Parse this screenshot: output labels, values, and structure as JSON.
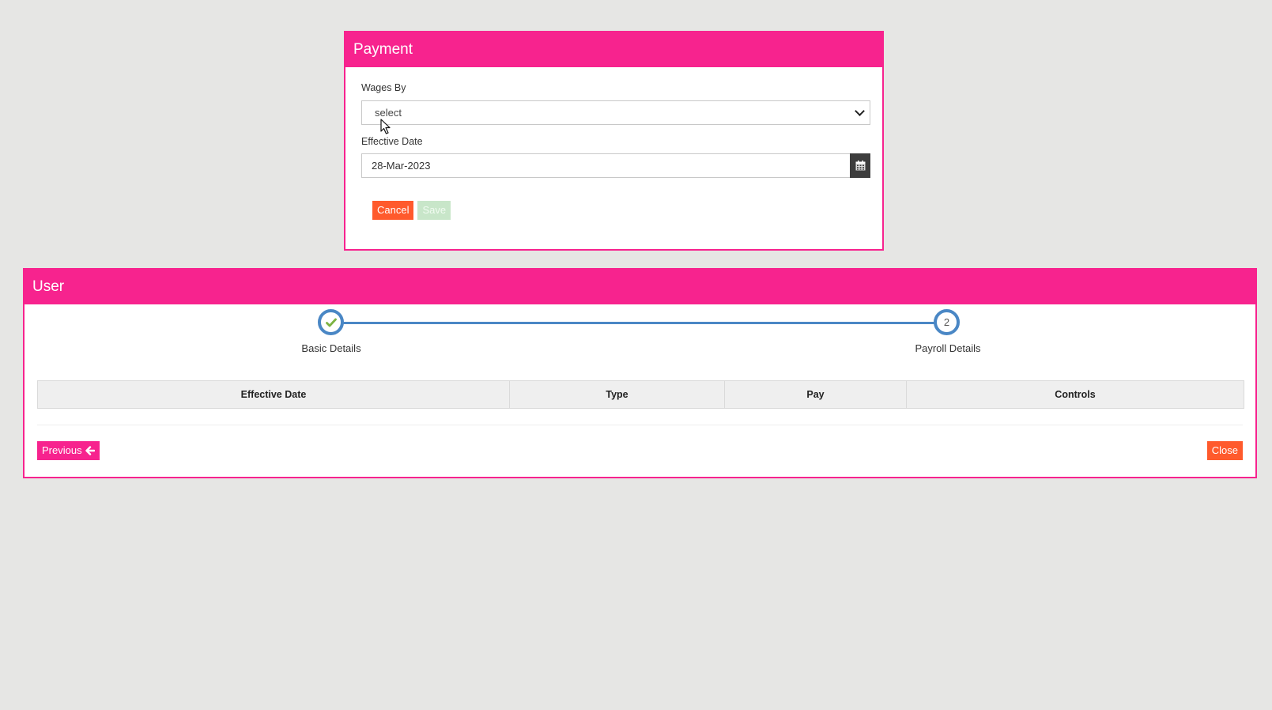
{
  "payment_modal": {
    "title": "Payment",
    "wages_by_label": "Wages By",
    "wages_by_selected": "select",
    "effective_date_label": "Effective Date",
    "effective_date_value": "28-Mar-2023",
    "cancel_label": "Cancel",
    "save_label": "Save"
  },
  "user_panel": {
    "title": "User",
    "steps": [
      {
        "label": "Basic Details",
        "status": "complete"
      },
      {
        "label": "Payroll Details",
        "number": "2",
        "status": "current"
      }
    ],
    "table_headers": [
      "Effective Date",
      "Type",
      "Pay",
      "Controls"
    ],
    "previous_label": "Previous",
    "close_label": "Close"
  },
  "colors": {
    "brand": "#f7238e",
    "danger": "#ff5a2c",
    "step_blue": "#4a87c5",
    "check_green": "#7cb342"
  }
}
